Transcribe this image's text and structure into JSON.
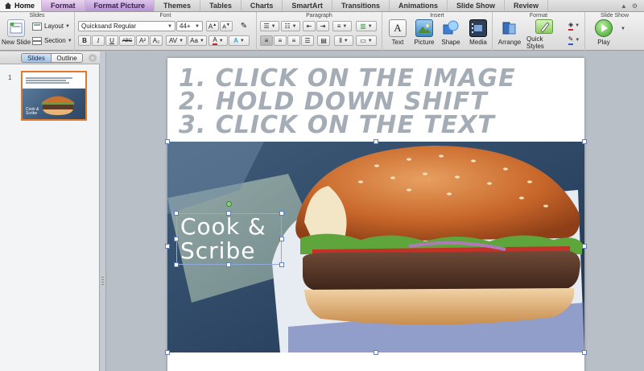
{
  "tabs": [
    {
      "label": "Home"
    },
    {
      "label": "Format"
    },
    {
      "label": "Format Picture"
    },
    {
      "label": "Themes"
    },
    {
      "label": "Tables"
    },
    {
      "label": "Charts"
    },
    {
      "label": "SmartArt"
    },
    {
      "label": "Transitions"
    },
    {
      "label": "Animations"
    },
    {
      "label": "Slide Show"
    },
    {
      "label": "Review"
    }
  ],
  "ribbon": {
    "slides": {
      "group_label": "Slides",
      "new_slide": "New Slide",
      "layout": "Layout",
      "section": "Section"
    },
    "font": {
      "group_label": "Font",
      "font_name": "Quicksand Regular",
      "font_size": "44+",
      "bold": "B",
      "italic": "I",
      "underline": "U",
      "strike": "ABC",
      "superscript": "A²",
      "subscript": "A₂",
      "char_spacing": "AV",
      "aa": "Aa"
    },
    "paragraph": {
      "group_label": "Paragraph"
    },
    "insert": {
      "group_label": "Insert",
      "text": "Text",
      "picture": "Picture",
      "shape": "Shape",
      "media": "Media"
    },
    "format": {
      "group_label": "Format",
      "arrange": "Arrange",
      "quick_styles": "Quick Styles"
    },
    "slideshow": {
      "group_label": "Slide Show",
      "play": "Play"
    }
  },
  "leftpane": {
    "tab_slides": "Slides",
    "tab_outline": "Outline",
    "slide_number": "1"
  },
  "slide": {
    "lines": [
      "1. CLICK ON THE IMAGE",
      "2. HOLD DOWN SHIFT",
      "3. CLICK ON THE TEXT"
    ],
    "logo_line1": "Cook &",
    "logo_line2": "Scribe"
  },
  "colors": {
    "accent_purple": "#c9a6d6",
    "instruction_text": "#a4acb5",
    "selection": "#5b7fbf",
    "thumb_border": "#e2782a"
  }
}
